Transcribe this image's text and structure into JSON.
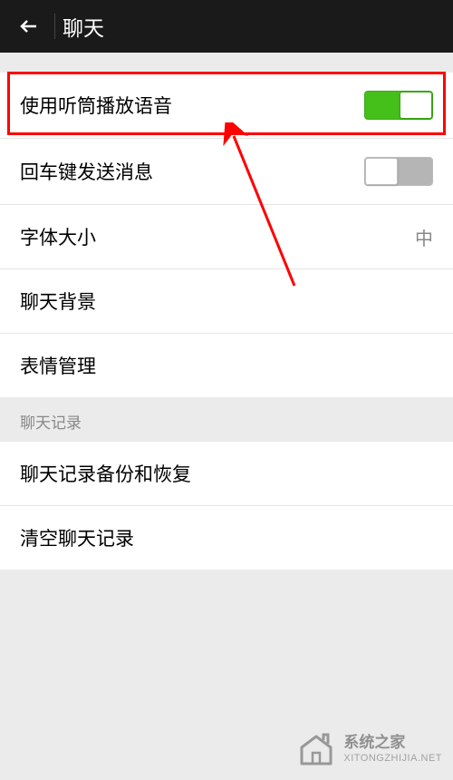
{
  "header": {
    "title": "聊天"
  },
  "settings": {
    "earpiece_audio": {
      "label": "使用听筒播放语音",
      "enabled": true
    },
    "enter_send": {
      "label": "回车键发送消息",
      "enabled": false
    },
    "font_size": {
      "label": "字体大小",
      "value": "中"
    },
    "chat_background": {
      "label": "聊天背景"
    },
    "sticker_management": {
      "label": "表情管理"
    }
  },
  "section": {
    "chat_history": {
      "title": "聊天记录",
      "backup_restore": {
        "label": "聊天记录备份和恢复"
      },
      "clear": {
        "label": "清空聊天记录"
      }
    }
  },
  "watermark": {
    "name": "系统之家",
    "url": "XITONGZHIJIA.NET"
  }
}
